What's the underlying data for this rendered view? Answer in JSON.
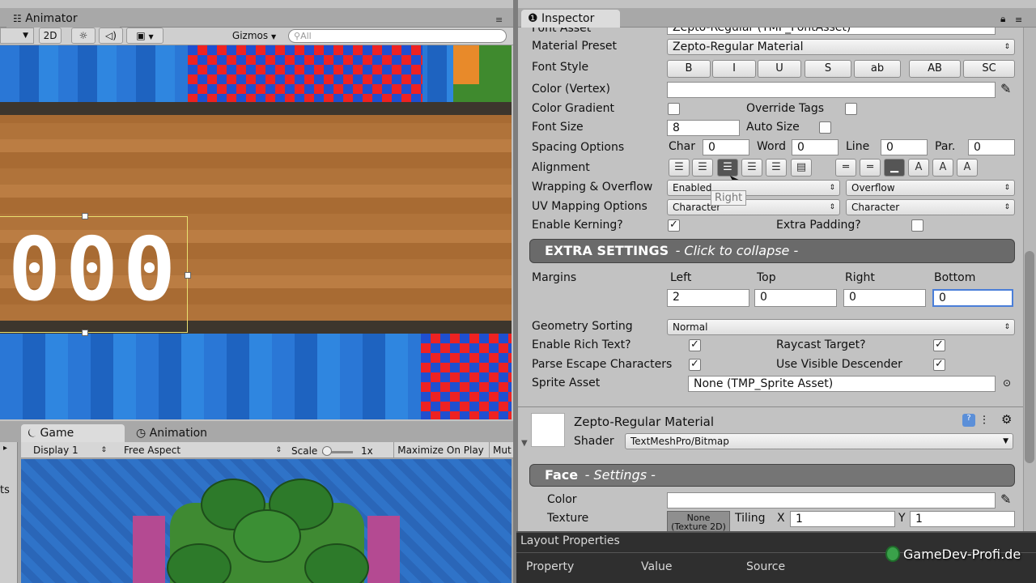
{
  "scene": {
    "tab_label": "Animator",
    "mode_2d": "2D",
    "gizmos": "Gizmos",
    "search_placeholder": "All",
    "score_text": "000"
  },
  "inspector": {
    "tab_label": "Inspector",
    "font_asset_label": "Font Asset",
    "font_asset_value": "Zepto-Regular (TMP_FontAsset)",
    "material_preset_label": "Material Preset",
    "material_preset_value": "Zepto-Regular Material",
    "font_style_label": "Font Style",
    "font_style_buttons": [
      "B",
      "I",
      "U",
      "S",
      "ab",
      "AB",
      "SC"
    ],
    "color_vertex_label": "Color (Vertex)",
    "color_gradient_label": "Color Gradient",
    "override_tags_label": "Override Tags",
    "font_size_label": "Font Size",
    "font_size_value": "8",
    "auto_size_label": "Auto Size",
    "spacing_label": "Spacing Options",
    "char_label": "Char",
    "char_value": "0",
    "word_label": "Word",
    "word_value": "0",
    "line_label": "Line",
    "line_value": "0",
    "par_label": "Par.",
    "par_value": "0",
    "alignment_label": "Alignment",
    "tooltip": "Right",
    "wrapping_label": "Wrapping & Overflow",
    "wrapping_value": "Enabled",
    "overflow_value": "Overflow",
    "uv_label": "UV Mapping Options",
    "uv_h_value": "Character",
    "uv_v_value": "Character",
    "kerning_label": "Enable Kerning?",
    "extra_padding_label": "Extra Padding?",
    "extra_settings_title": "EXTRA SETTINGS",
    "extra_settings_hint": "- Click to collapse -",
    "margins_label": "Margins",
    "margin_left_label": "Left",
    "margin_left": "2",
    "margin_top_label": "Top",
    "margin_top": "0",
    "margin_right_label": "Right",
    "margin_right": "0",
    "margin_bottom_label": "Bottom",
    "margin_bottom": "0",
    "geometry_label": "Geometry Sorting",
    "geometry_value": "Normal",
    "rich_text_label": "Enable Rich Text?",
    "raycast_label": "Raycast Target?",
    "escape_label": "Parse Escape Characters",
    "visible_desc_label": "Use Visible Descender",
    "sprite_label": "Sprite Asset",
    "sprite_value": "None (TMP_Sprite Asset)",
    "material_name": "Zepto-Regular Material",
    "shader_label": "Shader",
    "shader_value": "TextMeshPro/Bitmap",
    "face_title": "Face",
    "face_hint": "- Settings -",
    "face_color_label": "Color",
    "texture_label": "Texture",
    "texture_value": "None (Texture 2D)",
    "tiling_label": "Tiling",
    "tiling_x_label": "X",
    "tiling_x": "1",
    "tiling_y_label": "Y",
    "tiling_y": "1"
  },
  "layout_props": {
    "title": "Layout Properties",
    "col_property": "Property",
    "col_value": "Value",
    "col_source": "Source"
  },
  "game": {
    "tab_game": "Game",
    "tab_animation": "Animation",
    "display": "Display 1",
    "aspect": "Free Aspect",
    "scale_label": "Scale",
    "scale_value": "1x",
    "maximize": "Maximize On Play",
    "mute": "Mut",
    "left_stub": "ts"
  },
  "watermark": "GameDev-Profi.de"
}
